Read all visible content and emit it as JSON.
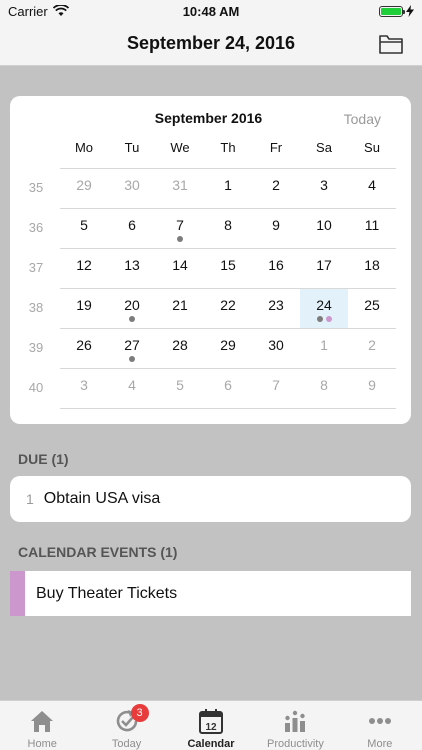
{
  "status_bar": {
    "carrier": "Carrier",
    "time": "10:48 AM"
  },
  "nav": {
    "title": "September 24, 2016"
  },
  "calendar": {
    "month_label": "September 2016",
    "today_label": "Today",
    "weekdays": [
      "Mo",
      "Tu",
      "We",
      "Th",
      "Fr",
      "Sa",
      "Su"
    ],
    "weeks": [
      {
        "num": "35",
        "days": [
          {
            "d": "29",
            "muted": true
          },
          {
            "d": "30",
            "muted": true
          },
          {
            "d": "31",
            "muted": true
          },
          {
            "d": "1"
          },
          {
            "d": "2"
          },
          {
            "d": "3"
          },
          {
            "d": "4"
          }
        ]
      },
      {
        "num": "36",
        "days": [
          {
            "d": "5"
          },
          {
            "d": "6"
          },
          {
            "d": "7",
            "dots": [
              "gray"
            ]
          },
          {
            "d": "8"
          },
          {
            "d": "9"
          },
          {
            "d": "10"
          },
          {
            "d": "11"
          }
        ]
      },
      {
        "num": "37",
        "days": [
          {
            "d": "12"
          },
          {
            "d": "13"
          },
          {
            "d": "14"
          },
          {
            "d": "15"
          },
          {
            "d": "16"
          },
          {
            "d": "17"
          },
          {
            "d": "18"
          }
        ]
      },
      {
        "num": "38",
        "days": [
          {
            "d": "19"
          },
          {
            "d": "20",
            "dots": [
              "gray"
            ]
          },
          {
            "d": "21"
          },
          {
            "d": "22"
          },
          {
            "d": "23"
          },
          {
            "d": "24",
            "selected": true,
            "dots": [
              "gray",
              "pink"
            ]
          },
          {
            "d": "25"
          }
        ]
      },
      {
        "num": "39",
        "days": [
          {
            "d": "26"
          },
          {
            "d": "27",
            "dots": [
              "gray"
            ]
          },
          {
            "d": "28"
          },
          {
            "d": "29"
          },
          {
            "d": "30"
          },
          {
            "d": "1",
            "muted": true
          },
          {
            "d": "2",
            "muted": true
          }
        ]
      },
      {
        "num": "40",
        "days": [
          {
            "d": "3",
            "muted": true
          },
          {
            "d": "4",
            "muted": true
          },
          {
            "d": "5",
            "muted": true
          },
          {
            "d": "6",
            "muted": true
          },
          {
            "d": "7",
            "muted": true
          },
          {
            "d": "8",
            "muted": true
          },
          {
            "d": "9",
            "muted": true
          }
        ]
      }
    ]
  },
  "due": {
    "header": "DUE (1)",
    "items": [
      {
        "num": "1",
        "title": "Obtain USA visa"
      }
    ]
  },
  "events": {
    "header": "CALENDAR EVENTS (1)",
    "items": [
      {
        "title": "Buy Theater Tickets",
        "color": "#cc97cc"
      }
    ]
  },
  "tabs": [
    {
      "label": "Home",
      "icon": "home-icon"
    },
    {
      "label": "Today",
      "icon": "today-refresh-icon",
      "badge": "3"
    },
    {
      "label": "Calendar",
      "icon": "calendar-icon",
      "icon_text": "12",
      "active": true
    },
    {
      "label": "Productivity",
      "icon": "productivity-icon"
    },
    {
      "label": "More",
      "icon": "more-icon"
    }
  ],
  "colors": {
    "accent_selected": "#e3f1fb",
    "dot_gray": "#7c7c7c",
    "dot_pink": "#cc97cc",
    "badge_red": "#e83b3b"
  }
}
